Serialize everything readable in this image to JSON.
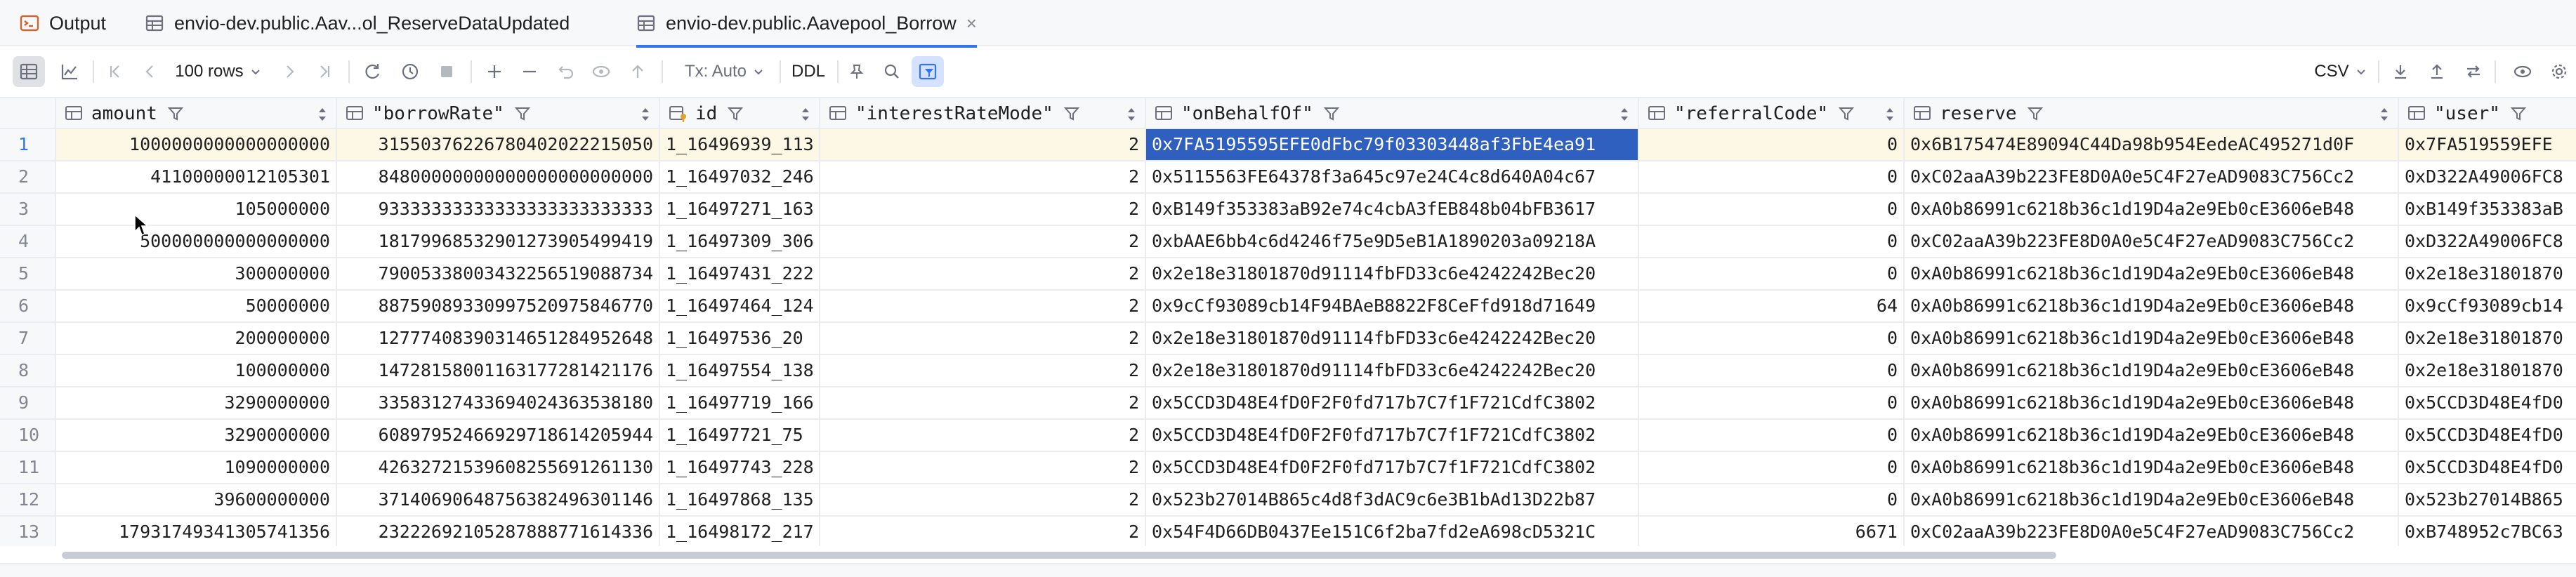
{
  "tabs": [
    {
      "label": "Output",
      "icon": "console-icon"
    },
    {
      "label": "envio-dev.public.Aav...ol_ReserveDataUpdated",
      "icon": "table-icon"
    },
    {
      "label": "envio-dev.public.Aavepool_Borrow",
      "icon": "table-icon",
      "active": true,
      "close": "×"
    }
  ],
  "toolbar": {
    "page_size": "100 rows",
    "tx_mode": "Tx: Auto",
    "ddl_label": "DDL",
    "export_format": "CSV"
  },
  "columns": [
    {
      "name": "amount"
    },
    {
      "name": "\"borrowRate\""
    },
    {
      "name": "id",
      "key": true
    },
    {
      "name": "\"interestRateMode\""
    },
    {
      "name": "\"onBehalfOf\""
    },
    {
      "name": "\"referralCode\""
    },
    {
      "name": "reserve"
    },
    {
      "name": "\"user\""
    }
  ],
  "rows": [
    {
      "n": "1",
      "cells": [
        "1000000000000000000",
        "31550376226780402022215050",
        "1_16496939_113",
        "2",
        "0x7FA5195595EFE0dFbc79f03303448af3FbE4ea91",
        "0",
        "0x6B175474E89094C44Da98b954EedeAC495271d0F",
        "0x7FA519559EFE"
      ]
    },
    {
      "n": "2",
      "cells": [
        "41100000012105301",
        "84800000000000000000000000",
        "1_16497032_246",
        "2",
        "0x5115563FE64378f3a645c97e24C4c8d640A04c67",
        "0",
        "0xC02aaA39b223FE8D0A0e5C4F27eAD9083C756Cc2",
        "0xD322A49006FC8"
      ]
    },
    {
      "n": "3",
      "cells": [
        "105000000",
        "93333333333333333333333333",
        "1_16497271_163",
        "2",
        "0xB149f353383aB92e74c4cbA3fEB848b04bFB3617",
        "0",
        "0xA0b86991c6218b36c1d19D4a2e9Eb0cE3606eB48",
        "0xB149f353383aB"
      ]
    },
    {
      "n": "4",
      "cells": [
        "500000000000000000",
        "18179968532901273905499419",
        "1_16497309_306",
        "2",
        "0xbAAE6bb4c6d4246f75e9D5eB1A1890203a09218A",
        "0",
        "0xC02aaA39b223FE8D0A0e5C4F27eAD9083C756Cc2",
        "0xD322A49006FC8"
      ]
    },
    {
      "n": "5",
      "cells": [
        "300000000",
        "79005338003432256519088734",
        "1_16497431_222",
        "2",
        "0x2e18e31801870d91114fbFD33c6e4242242Bec20",
        "0",
        "0xA0b86991c6218b36c1d19D4a2e9Eb0cE3606eB48",
        "0x2e18e31801870"
      ]
    },
    {
      "n": "6",
      "cells": [
        "50000000",
        "88759089330997520975846770",
        "1_16497464_124",
        "2",
        "0x9cCf93089cb14F94BAeB8822F8CeFfd918d71649",
        "64",
        "0xA0b86991c6218b36c1d19D4a2e9Eb0cE3606eB48",
        "0x9cCf93089cb14"
      ]
    },
    {
      "n": "7",
      "cells": [
        "200000000",
        "12777408390314651284952648",
        "1_16497536_20",
        "2",
        "0x2e18e31801870d91114fbFD33c6e4242242Bec20",
        "0",
        "0xA0b86991c6218b36c1d19D4a2e9Eb0cE3606eB48",
        "0x2e18e31801870"
      ]
    },
    {
      "n": "8",
      "cells": [
        "100000000",
        "14728158001163177281421176",
        "1_16497554_138",
        "2",
        "0x2e18e31801870d91114fbFD33c6e4242242Bec20",
        "0",
        "0xA0b86991c6218b36c1d19D4a2e9Eb0cE3606eB48",
        "0x2e18e31801870"
      ]
    },
    {
      "n": "9",
      "cells": [
        "3290000000",
        "33583127433694024363538180",
        "1_16497719_166",
        "2",
        "0x5CCD3D48E4fD0F2F0fd717b7C7f1F721CdfC3802",
        "0",
        "0xA0b86991c6218b36c1d19D4a2e9Eb0cE3606eB48",
        "0x5CCD3D48E4fD0"
      ]
    },
    {
      "n": "10",
      "cells": [
        "3290000000",
        "60897952466929718614205944",
        "1_16497721_75",
        "2",
        "0x5CCD3D48E4fD0F2F0fd717b7C7f1F721CdfC3802",
        "0",
        "0xA0b86991c6218b36c1d19D4a2e9Eb0cE3606eB48",
        "0x5CCD3D48E4fD0"
      ]
    },
    {
      "n": "11",
      "cells": [
        "1090000000",
        "42632721539608255691261130",
        "1_16497743_228",
        "2",
        "0x5CCD3D48E4fD0F2F0fd717b7C7f1F721CdfC3802",
        "0",
        "0xA0b86991c6218b36c1d19D4a2e9Eb0cE3606eB48",
        "0x5CCD3D48E4fD0"
      ]
    },
    {
      "n": "12",
      "cells": [
        "39600000000",
        "37140690648756382496301146",
        "1_16497868_135",
        "2",
        "0x523b27014B865c4d8f3dAC9c6e3B1bAd13D22b87",
        "0",
        "0xA0b86991c6218b36c1d19D4a2e9Eb0cE3606eB48",
        "0x523b27014B865"
      ]
    },
    {
      "n": "13",
      "cells": [
        "17931749341305741356",
        "23222692105287888771614336",
        "1_16498172_217",
        "2",
        "0x54F4D66DB0437Ee151C6f2ba7fd2eA698cD5321C",
        "6671",
        "0xC02aaA39b223FE8D0A0e5C4F27eAD9083C756Cc2",
        "0xB748952c7BC63"
      ]
    }
  ],
  "colors": {
    "accent": "#3574f0",
    "selection": "#2f5fbf",
    "current_row": "#fdf8e6"
  }
}
